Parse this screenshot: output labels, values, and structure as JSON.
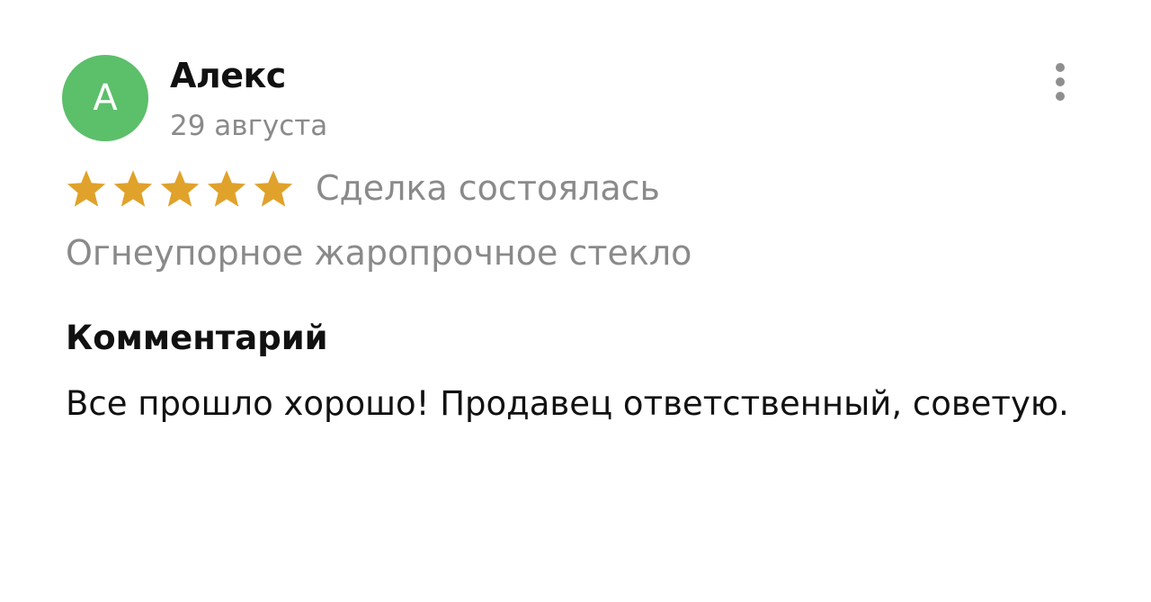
{
  "author": {
    "avatar_letter": "А",
    "name": "Алекс",
    "date": "29 августа"
  },
  "menu": {
    "icon": "more-vertical-icon"
  },
  "rating": {
    "value": 5,
    "max": 5,
    "star_color": "#e0a22a",
    "status": "Сделка состоялась"
  },
  "product": {
    "title": "Огнеупорное жаропрочное стекло"
  },
  "comment": {
    "heading": "Комментарий",
    "text": "Все прошло хорошо! Продавец ответственный, советую."
  },
  "colors": {
    "avatar_bg": "#5cbf6a",
    "secondary_text": "#8a8a8a"
  }
}
